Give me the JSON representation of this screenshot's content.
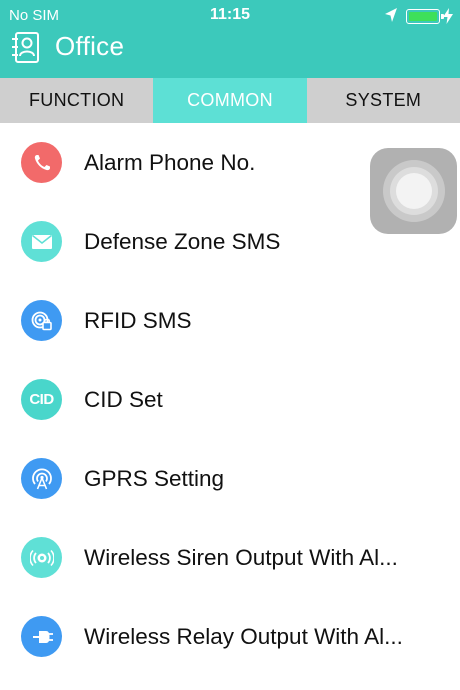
{
  "status_bar": {
    "carrier": "No SIM",
    "time": "11:15",
    "icons": [
      "location-arrow-icon",
      "battery-icon",
      "charging-bolt-icon"
    ],
    "battery_color": "#3ee05a"
  },
  "app_bar": {
    "title": "Office",
    "icon": "contacts-book-icon",
    "background": "#3cc9bb"
  },
  "tabs": [
    {
      "label": "FUNCTION",
      "active": false
    },
    {
      "label": "COMMON",
      "active": true
    },
    {
      "label": "SYSTEM",
      "active": false
    }
  ],
  "tab_colors": {
    "active_bg": "#5de0d5",
    "inactive_bg": "#cfcfcf"
  },
  "menu_items": [
    {
      "label": "Alarm Phone No.",
      "icon": "phone-icon",
      "color": "#f26a6a"
    },
    {
      "label": "Defense Zone SMS",
      "icon": "envelope-icon",
      "color": "#5fe0d6"
    },
    {
      "label": "RFID SMS",
      "icon": "rfid-lock-icon",
      "color": "#3f9af2"
    },
    {
      "label": "CID Set",
      "icon": "cid-icon",
      "icon_text": "CID",
      "color": "#49d6cb"
    },
    {
      "label": "GPRS Setting",
      "icon": "gprs-antenna-icon",
      "color": "#3f9af2"
    },
    {
      "label": "Wireless Siren Output With Al...",
      "icon": "siren-icon",
      "color": "#5fe0d6"
    },
    {
      "label": "Wireless Relay Output With Al...",
      "icon": "relay-plug-icon",
      "color": "#3f9af2"
    }
  ],
  "assistive_touch": {
    "icon": "assistive-touch-icon"
  }
}
